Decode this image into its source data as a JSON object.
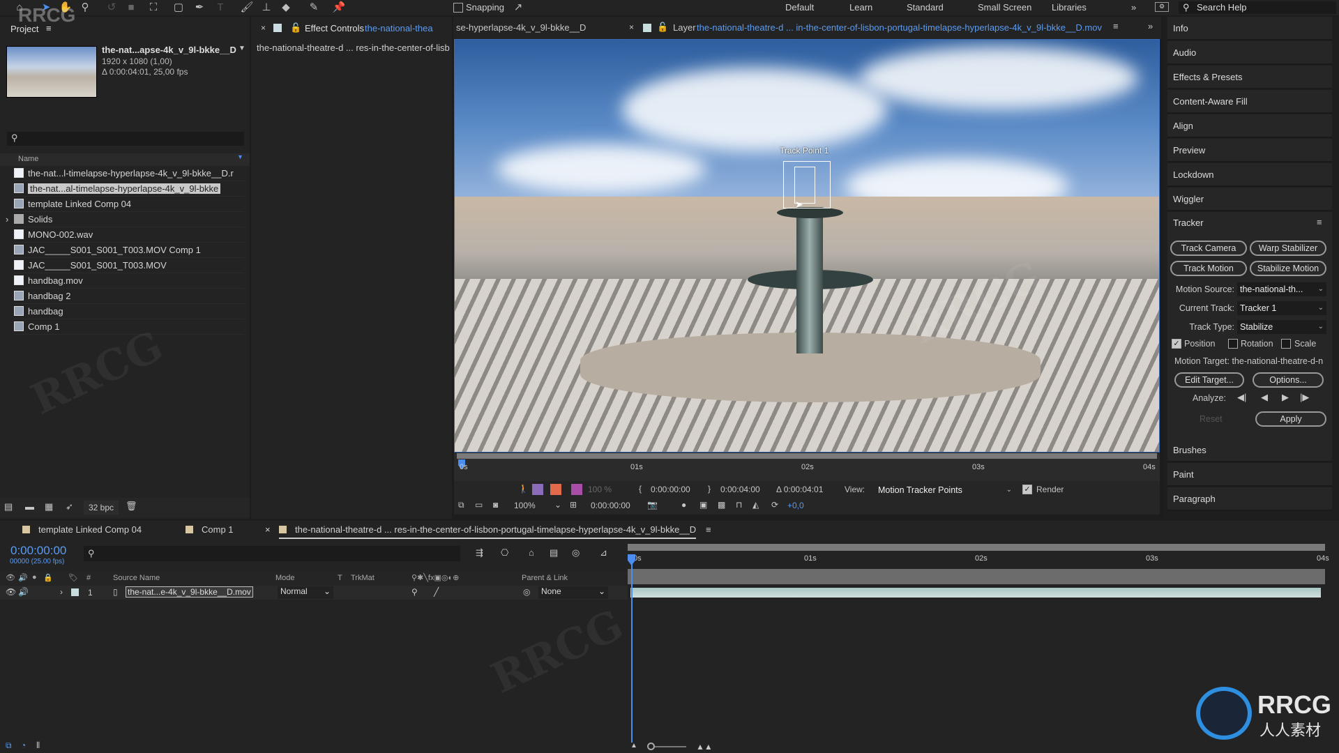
{
  "toolbar": {
    "tools": [
      "home-icon",
      "selection-tool-icon",
      "hand-tool-icon",
      "zoom-tool-icon",
      "rotate-tool-icon",
      "camera-tool-icon",
      "pan-behind-icon",
      "rectangle-tool-icon",
      "pen-tool-icon",
      "type-tool-icon",
      "brush-tool-icon",
      "clone-stamp-icon",
      "eraser-icon",
      "roto-brush-icon",
      "puppet-pin-icon"
    ],
    "snapping_label": "Snapping",
    "workspaces": [
      "Default",
      "Learn",
      "Standard",
      "Small Screen",
      "Libraries"
    ],
    "search_help": "Search Help"
  },
  "project": {
    "title": "Project",
    "selected_item": {
      "name": "the-nat...apse-4k_v_9l-bkke__D",
      "dimensions": "1920 x 1080 (1,00)",
      "duration": "Δ 0:00:04:01, 25,00 fps"
    },
    "column_name": "Name",
    "items": [
      {
        "label": "the-nat...l-timelapse-hyperlapse-4k_v_9l-bkke__D.r",
        "type": "footage",
        "selected": false
      },
      {
        "label": "the-nat...al-timelapse-hyperlapse-4k_v_9l-bkke",
        "type": "comp",
        "selected": true
      },
      {
        "label": "template Linked Comp 04",
        "type": "comp",
        "selected": false
      },
      {
        "label": "Solids",
        "type": "folder",
        "selected": false
      },
      {
        "label": "MONO-002.wav",
        "type": "audio",
        "selected": false
      },
      {
        "label": "JAC_____S001_S001_T003.MOV Comp 1",
        "type": "comp",
        "selected": false
      },
      {
        "label": "JAC_____S001_S001_T003.MOV",
        "type": "footage",
        "selected": false
      },
      {
        "label": "handbag.mov",
        "type": "footage",
        "selected": false
      },
      {
        "label": "handbag 2",
        "type": "comp",
        "selected": false
      },
      {
        "label": "handbag",
        "type": "comp",
        "selected": false
      },
      {
        "label": "Comp 1",
        "type": "comp",
        "selected": false
      }
    ],
    "bpc": "32 bpc"
  },
  "effect_controls": {
    "title": "Effect Controls",
    "layer_link": "the-national-thea",
    "subtitle": "the-national-theatre-d ... res-in-the-center-of-lisb"
  },
  "viewer": {
    "comp_tab": "se-hyperlapse-4k_v_9l-bkke__D",
    "layer_tab_prefix": "Layer",
    "layer_tab_name": "the-national-theatre-d ... in-the-center-of-lisbon-portugal-timelapse-hyperlapse-4k_v_9l-bkke__D.mov",
    "track_point_label": "Track Point 1",
    "ruler": [
      "0s",
      "01s",
      "02s",
      "03s",
      "04s"
    ],
    "opacity": "100 %",
    "in_point": "0:00:00:00",
    "out_point": "0:00:04:00",
    "duration": "Δ 0:00:04:01",
    "view_label": "View:",
    "view_value": "Motion Tracker Points",
    "render_label": "Render",
    "render_checked": true,
    "zoom": "100%",
    "current_time": "0:00:00:00",
    "exposure": "+0,0"
  },
  "right_panels": {
    "top": [
      "Info",
      "Audio",
      "Effects & Presets",
      "Content-Aware Fill",
      "Align",
      "Preview",
      "Lockdown",
      "Wiggler"
    ],
    "bottom": [
      "Brushes",
      "Paint",
      "Paragraph"
    ]
  },
  "tracker": {
    "title": "Tracker",
    "buttons": {
      "track_camera": "Track Camera",
      "warp_stabilizer": "Warp Stabilizer",
      "track_motion": "Track Motion",
      "stabilize_motion": "Stabilize Motion"
    },
    "motion_source_label": "Motion Source:",
    "motion_source_value": "the-national-th...",
    "current_track_label": "Current Track:",
    "current_track_value": "Tracker 1",
    "track_type_label": "Track Type:",
    "track_type_value": "Stabilize",
    "position_label": "Position",
    "position_checked": true,
    "rotation_label": "Rotation",
    "rotation_checked": false,
    "scale_label": "Scale",
    "scale_checked": false,
    "motion_target": "Motion Target: the-national-theatre-d-n",
    "edit_target": "Edit Target...",
    "options": "Options...",
    "analyze_label": "Analyze:",
    "reset": "Reset",
    "apply": "Apply"
  },
  "timeline": {
    "tabs": [
      "template Linked Comp 04",
      "Comp 1",
      "the-national-theatre-d ... res-in-the-center-of-lisbon-portugal-timelapse-hyperlapse-4k_v_9l-bkke__D"
    ],
    "timecode": "0:00:00:00",
    "frame_info": "00000 (25.00 fps)",
    "columns": {
      "source_name": "Source Name",
      "mode": "Mode",
      "t": "T",
      "trkmat": "TrkMat",
      "parent": "Parent & Link",
      "num": "#"
    },
    "ruler": [
      "0s",
      "01s",
      "02s",
      "03s",
      "04s"
    ],
    "layers": [
      {
        "index": "1",
        "name": "the-nat...e-4k_v_9l-bkke__D.mov",
        "mode": "Normal",
        "parent": "None"
      }
    ]
  },
  "watermark": {
    "logo": "RRCG",
    "sub": "人人素材"
  }
}
